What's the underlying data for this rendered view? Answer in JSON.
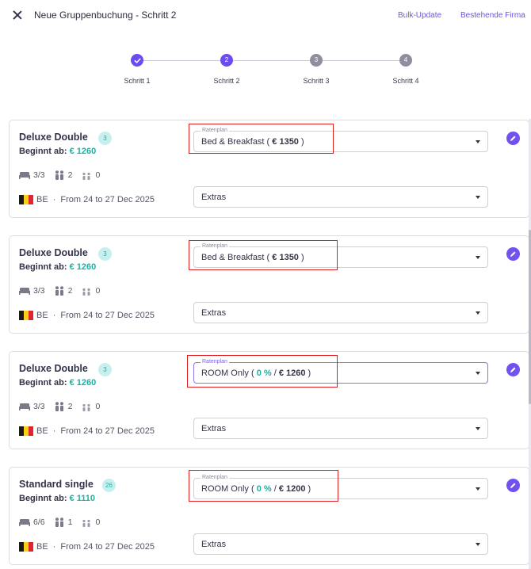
{
  "header": {
    "title": "Neue Gruppenbuchung - Schritt 2",
    "bulk_update": "Bulk-Update",
    "existing_company": "Bestehende Firma"
  },
  "stepper": {
    "steps": [
      {
        "label": "Schritt 1",
        "number": "1",
        "status": "done"
      },
      {
        "label": "Schritt 2",
        "number": "2",
        "status": "current"
      },
      {
        "label": "Schritt 3",
        "number": "3",
        "status": "pending"
      },
      {
        "label": "Schritt 4",
        "number": "4",
        "status": "pending"
      }
    ]
  },
  "rooms": [
    {
      "name": "Deluxe Double",
      "count": "3",
      "begins_label": "Beginnt ab:",
      "price": "€ 1260",
      "rooms_ratio": "3/3",
      "adults": "2",
      "children": "0",
      "country": "BE",
      "dates": "From 24 to 27 Dec 2025",
      "rate_label": "Ratenplan",
      "rate_plan": "Bed & Breakfast",
      "rate_pct": "",
      "rate_price": "€ 1350",
      "extras": "Extras"
    },
    {
      "name": "Deluxe Double",
      "count": "3",
      "begins_label": "Beginnt ab:",
      "price": "€ 1260",
      "rooms_ratio": "3/3",
      "adults": "2",
      "children": "0",
      "country": "BE",
      "dates": "From 24 to 27 Dec 2025",
      "rate_label": "Ratenplan",
      "rate_plan": "Bed & Breakfast",
      "rate_pct": "",
      "rate_price": "€ 1350",
      "extras": "Extras"
    },
    {
      "name": "Deluxe Double",
      "count": "3",
      "begins_label": "Beginnt ab:",
      "price": "€ 1260",
      "rooms_ratio": "3/3",
      "adults": "2",
      "children": "0",
      "country": "BE",
      "dates": "From 24 to 27 Dec 2025",
      "rate_label": "Ratenplan",
      "rate_plan": "ROOM Only",
      "rate_pct": "0 %",
      "rate_price": "€ 1260",
      "extras": "Extras"
    },
    {
      "name": "Standard single",
      "count": "26",
      "begins_label": "Beginnt ab:",
      "price": "€ 1110",
      "rooms_ratio": "6/6",
      "adults": "1",
      "children": "0",
      "country": "BE",
      "dates": "From 24 to 27 Dec 2025",
      "rate_label": "Ratenplan",
      "rate_plan": "ROOM Only",
      "rate_pct": "0 %",
      "rate_price": "€ 1200",
      "extras": "Extras"
    }
  ],
  "colors": {
    "accent": "#6c4cf0",
    "teal": "#17b3a5",
    "highlight": "#e02020"
  }
}
